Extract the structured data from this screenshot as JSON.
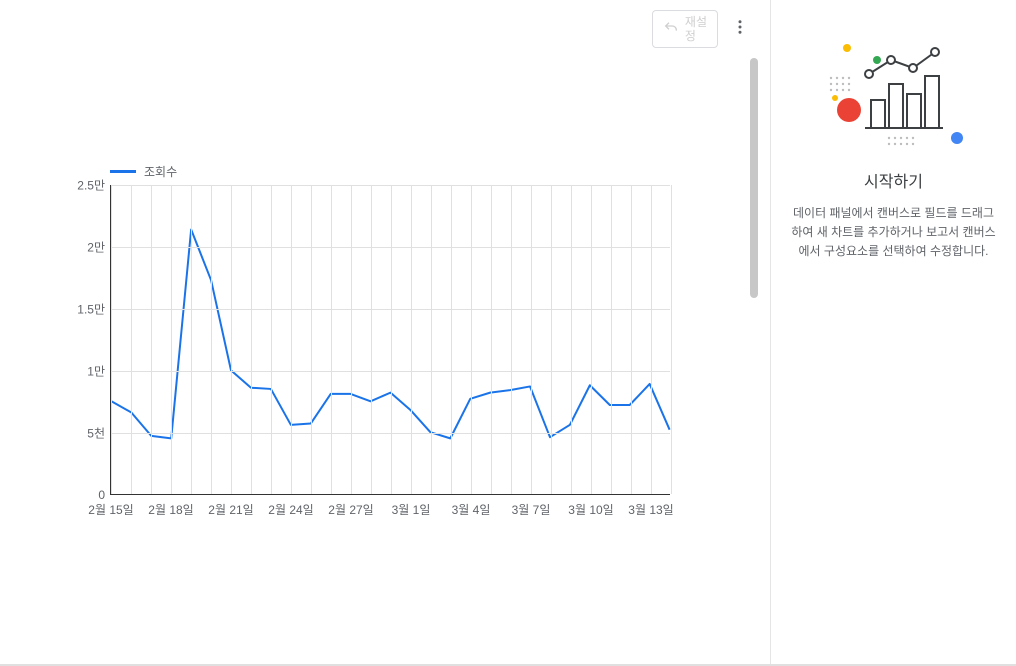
{
  "toolbar": {
    "reset_label": "재설\n정"
  },
  "sidebar": {
    "title": "시작하기",
    "description": "데이터 패널에서 캔버스로 필드를 드래그하여 새 차트를 추가하거나 보고서 캔버스에서 구성요소를 선택하여 수정합니다."
  },
  "chart_data": {
    "type": "line",
    "series": [
      {
        "name": "조회수",
        "x": [
          "2월 15일",
          "2월 16일",
          "2월 17일",
          "2월 18일",
          "2월 19일",
          "2월 20일",
          "2월 21일",
          "2월 22일",
          "2월 23일",
          "2월 24일",
          "2월 25일",
          "2월 26일",
          "2월 27일",
          "2월 28일",
          "3월 1일",
          "3월 2일",
          "3월 3일",
          "3월 4일",
          "3월 5일",
          "3월 6일",
          "3월 7일",
          "3월 8일",
          "3월 9일",
          "3월 10일",
          "3월 11일",
          "3월 12일",
          "3월 13일",
          "3월 14일",
          "3월 15일"
        ],
        "values": [
          7500,
          6600,
          4700,
          4500,
          21400,
          17300,
          10000,
          8600,
          8500,
          5600,
          5700,
          8100,
          8100,
          7500,
          8200,
          6800,
          5000,
          4500,
          7700,
          8200,
          8400,
          8700,
          4600,
          5600,
          8800,
          7200,
          7200,
          8900,
          5200
        ]
      }
    ],
    "x_tick_labels": [
      "2월 15일",
      "2월 18일",
      "2월 21일",
      "2월 24일",
      "2월 27일",
      "3월 1일",
      "3월 4일",
      "3월 7일",
      "3월 10일",
      "3월 13일"
    ],
    "x_tick_indices": [
      0,
      3,
      6,
      9,
      12,
      15,
      18,
      21,
      24,
      27
    ],
    "y_ticks": [
      0,
      5000,
      10000,
      15000,
      20000,
      25000
    ],
    "y_tick_labels": [
      "0",
      "5천",
      "1만",
      "1.5만",
      "2만",
      "2.5만"
    ],
    "ylim": [
      0,
      25000
    ],
    "legend": "조회수",
    "color": "#1a73e8",
    "title": "",
    "xlabel": "",
    "ylabel": ""
  }
}
